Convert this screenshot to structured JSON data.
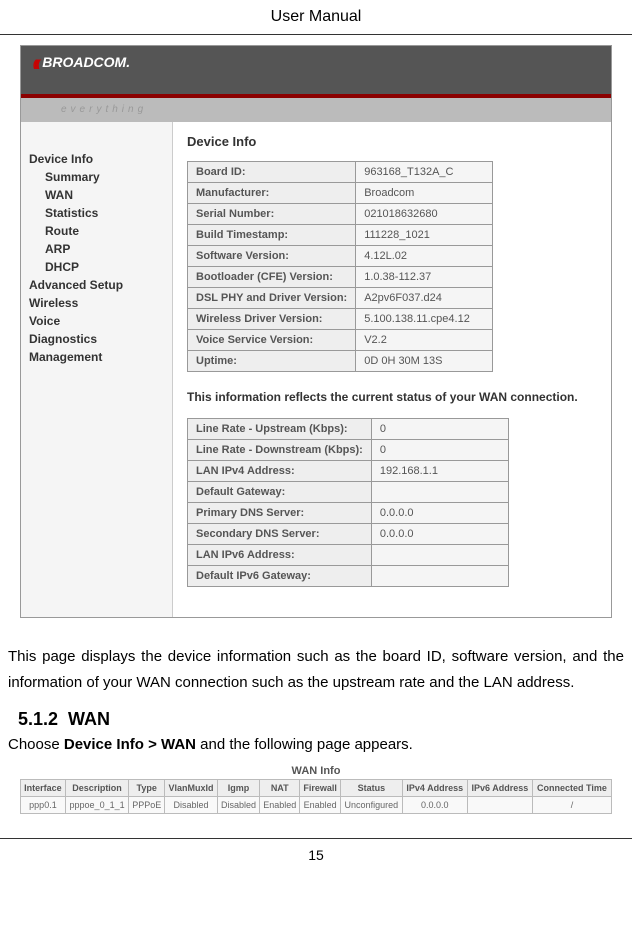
{
  "doc": {
    "title": "User Manual",
    "page_number": "15"
  },
  "router_header": {
    "logo": "BROADCOM.",
    "tagline": "everything"
  },
  "sidebar": {
    "items": [
      {
        "label": "Device Info",
        "indent": 0
      },
      {
        "label": "Summary",
        "indent": 1
      },
      {
        "label": "WAN",
        "indent": 1
      },
      {
        "label": "Statistics",
        "indent": 1
      },
      {
        "label": "Route",
        "indent": 1
      },
      {
        "label": "ARP",
        "indent": 1
      },
      {
        "label": "DHCP",
        "indent": 1
      },
      {
        "label": "Advanced Setup",
        "indent": 0
      },
      {
        "label": "Wireless",
        "indent": 0
      },
      {
        "label": "Voice",
        "indent": 0
      },
      {
        "label": "Diagnostics",
        "indent": 0
      },
      {
        "label": "Management",
        "indent": 0
      }
    ]
  },
  "device_info": {
    "title": "Device Info",
    "rows": [
      {
        "label": "Board ID:",
        "value": "963168_T132A_C"
      },
      {
        "label": "Manufacturer:",
        "value": "Broadcom"
      },
      {
        "label": "Serial Number:",
        "value": "021018632680"
      },
      {
        "label": "Build Timestamp:",
        "value": "111228_1021"
      },
      {
        "label": "Software Version:",
        "value": "4.12L.02"
      },
      {
        "label": "Bootloader (CFE) Version:",
        "value": "1.0.38-112.37"
      },
      {
        "label": "DSL PHY and Driver Version:",
        "value": "A2pv6F037.d24"
      },
      {
        "label": "Wireless Driver Version:",
        "value": "5.100.138.11.cpe4.12"
      },
      {
        "label": "Voice Service Version:",
        "value": "V2.2"
      },
      {
        "label": "Uptime:",
        "value": "0D 0H 30M 13S"
      }
    ]
  },
  "wan_status": {
    "text": "This information reflects the current status of your WAN connection.",
    "rows": [
      {
        "label": "Line Rate - Upstream (Kbps):",
        "value": "0"
      },
      {
        "label": "Line Rate - Downstream (Kbps):",
        "value": "0"
      },
      {
        "label": "LAN IPv4 Address:",
        "value": "192.168.1.1"
      },
      {
        "label": "Default Gateway:",
        "value": ""
      },
      {
        "label": "Primary DNS Server:",
        "value": "0.0.0.0"
      },
      {
        "label": "Secondary DNS Server:",
        "value": "0.0.0.0"
      },
      {
        "label": "LAN IPv6 Address:",
        "value": ""
      },
      {
        "label": "Default IPv6 Gateway:",
        "value": ""
      }
    ]
  },
  "body": {
    "paragraph1": "This page displays the device information such as the board ID, software version, and the information of your WAN connection such as the upstream rate and the LAN address.",
    "section_num": "5.1.2",
    "section_title": "WAN",
    "choose_prefix": "Choose ",
    "choose_bold": "Device Info > WAN",
    "choose_suffix": " and the following page appears."
  },
  "wan_info": {
    "title": "WAN Info",
    "headers": [
      "Interface",
      "Description",
      "Type",
      "VlanMuxId",
      "Igmp",
      "NAT",
      "Firewall",
      "Status",
      "IPv4 Address",
      "IPv6 Address",
      "Connected Time"
    ],
    "row": [
      "ppp0.1",
      "pppoe_0_1_1",
      "PPPoE",
      "Disabled",
      "Disabled",
      "Enabled",
      "Enabled",
      "Unconfigured",
      "0.0.0.0",
      "",
      "/"
    ]
  }
}
